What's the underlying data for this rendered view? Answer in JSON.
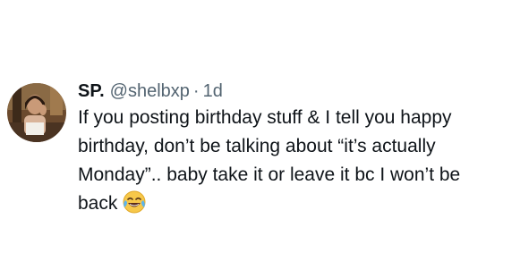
{
  "tweet": {
    "display_name": "SP.",
    "handle": "@shelbxp",
    "separator": "·",
    "time": "1d",
    "lines": [
      "If you posting birthday stuff & I tell you happy",
      "birthday, don’t be talking about “it’s actually",
      "Monday”.. baby take it or leave it bc I won’t be",
      "back"
    ],
    "emoji": "face-with-tears-of-joy-icon"
  }
}
